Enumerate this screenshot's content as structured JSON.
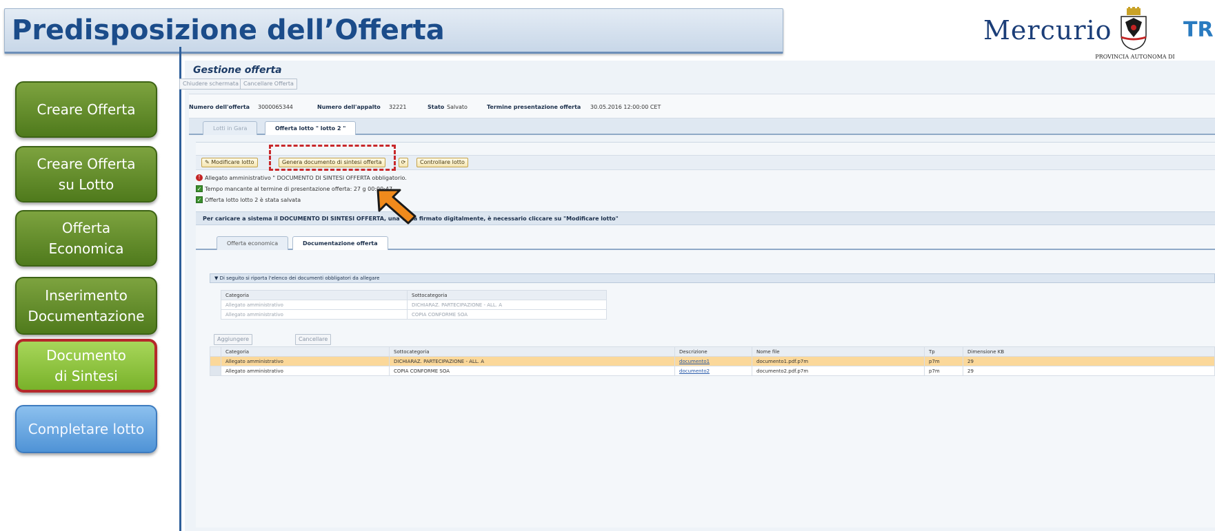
{
  "banner": {
    "title": "Predisposizione dell’Offerta"
  },
  "logos": {
    "mercurio": "Mercurio",
    "provincia": "PROVINCIA AUTONOMA DI TRENTO",
    "trentino": "TRE"
  },
  "nav": {
    "items": [
      {
        "label": "Creare Offerta"
      },
      {
        "label": "Creare Offerta su Lotto"
      },
      {
        "label": "Offerta Economica"
      },
      {
        "label": "Inserimento Documentazione"
      },
      {
        "label": "Documento di Sintesi"
      },
      {
        "label": "Completare lotto"
      }
    ],
    "active_index": 4
  },
  "app": {
    "title": "Gestione offerta",
    "top_buttons": {
      "close": "Chiudere schermata",
      "cancel": "Cancellare Offerta"
    },
    "info": {
      "offer_number_label": "Numero dell'offerta",
      "offer_number": "3000065344",
      "tender_number_label": "Numero dell'appalto",
      "tender_number": "32221",
      "state_label": "Stato",
      "state": "Salvato",
      "deadline_label": "Termine presentazione offerta",
      "deadline": "30.05.2016 12:00:00 CET"
    },
    "tabs": [
      "Lotti in Gara",
      "Offerta lotto \" lotto 2 \""
    ],
    "toolbar": {
      "modify": "Modificare lotto",
      "generate": "Genera documento di sintesi offerta",
      "check": "Controllare lotto"
    },
    "messages": [
      {
        "type": "error",
        "text": "Allegato amministrativo \" DOCUMENTO DI SINTESI OFFERTA obbligatorio."
      },
      {
        "type": "ok",
        "text": "Tempo mancante al termine di presentazione offerta: 27 g 00:00:47"
      },
      {
        "type": "ok",
        "text": "Offerta lotto lotto 2 è stata salvata"
      }
    ],
    "notice": "Per caricare a sistema il DOCUMENTO DI SINTESI OFFERTA, una volta firmato digitalmente, è necessario cliccare su \"Modificare lotto\"",
    "subtabs": [
      "Offerta economica",
      "Documentazione offerta"
    ],
    "required_docs": {
      "header": "Di seguito si riporta l'elenco dei documenti obbligatori da allegare",
      "columns": [
        "Categoria",
        "Sottocategoria"
      ],
      "rows": [
        [
          "Allegato amministrativo",
          "DICHIARAZ. PARTECIPAZIONE - ALL. A"
        ],
        [
          "Allegato amministrativo",
          "COPIA CONFORME SOA"
        ]
      ]
    },
    "attachments": {
      "add_button": "Aggiungere allegato firmato",
      "delete_button": "Cancellare",
      "columns": [
        "Categoria",
        "Sottocategoria",
        "Descrizione",
        "Nome file",
        "Tp",
        "Dimensione KB"
      ],
      "rows": [
        [
          "Allegato amministrativo",
          "DICHIARAZ. PARTECIPAZIONE - ALL. A",
          "documento1",
          "documento1.pdf.p7m",
          "p7m",
          "29"
        ],
        [
          "Allegato amministrativo",
          "COPIA CONFORME SOA",
          "documento2",
          "documento2.pdf.p7m",
          "p7m",
          "29"
        ]
      ],
      "selected_row": 0
    }
  },
  "colors": {
    "accent_red": "#c8282b",
    "brand_blue": "#1b4c8a",
    "nav_green": "#4f7a1c",
    "arrow_orange": "#f08a1c"
  }
}
